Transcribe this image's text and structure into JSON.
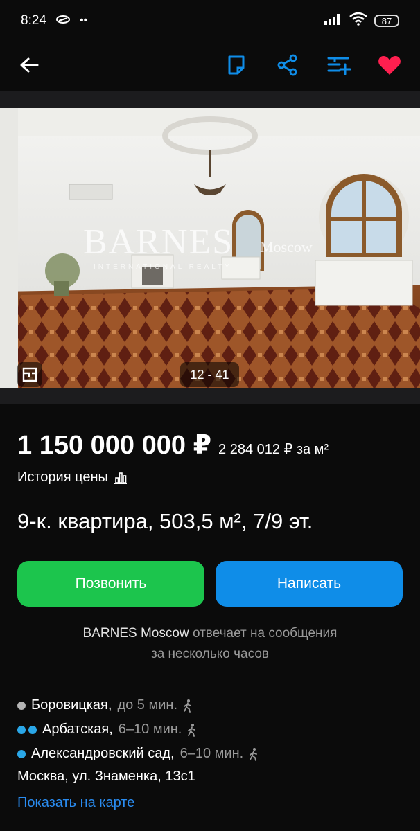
{
  "status_bar": {
    "time": "8:24",
    "battery": "87"
  },
  "colors": {
    "accent_blue": "#0f8de8",
    "call_green": "#1cc54d",
    "heart_red": "#ff1f4f",
    "link_blue": "#2a8cf0",
    "metro_grey": "#b5b5b5",
    "metro_blue": "#2aa7e8"
  },
  "toolbar": {
    "back_icon": "arrow-left-icon",
    "note_icon": "note-icon",
    "share_icon": "share-icon",
    "compare_icon": "compare-list-icon",
    "favorite_icon": "heart-icon"
  },
  "gallery": {
    "watermark_brand": "BARNES",
    "watermark_city": "Moscow",
    "watermark_tag": "INTERNATIONAL REALTY",
    "counter": "12 - 41"
  },
  "listing": {
    "price": "1 150 000 000 ₽",
    "price_per_m2": "2 284 012 ₽ за м²",
    "price_history": "История цены",
    "title": "9-к. квартира, 503,5 м², 7/9 эт."
  },
  "actions": {
    "call": "Позвонить",
    "message": "Написать"
  },
  "seller": {
    "name": "BARNES Moscow",
    "reply_line1": "отвечает на сообщения",
    "reply_line2": "за несколько часов"
  },
  "metro": [
    {
      "name": "Боровицкая,",
      "time": "до 5 мин."
    },
    {
      "name": "Арбатская,",
      "time": "6–10 мин."
    },
    {
      "name": "Александровский сад,",
      "time": "6–10 мин."
    }
  ],
  "address": "Москва, ул. Знаменка, 13с1",
  "map_link": "Показать на карте"
}
